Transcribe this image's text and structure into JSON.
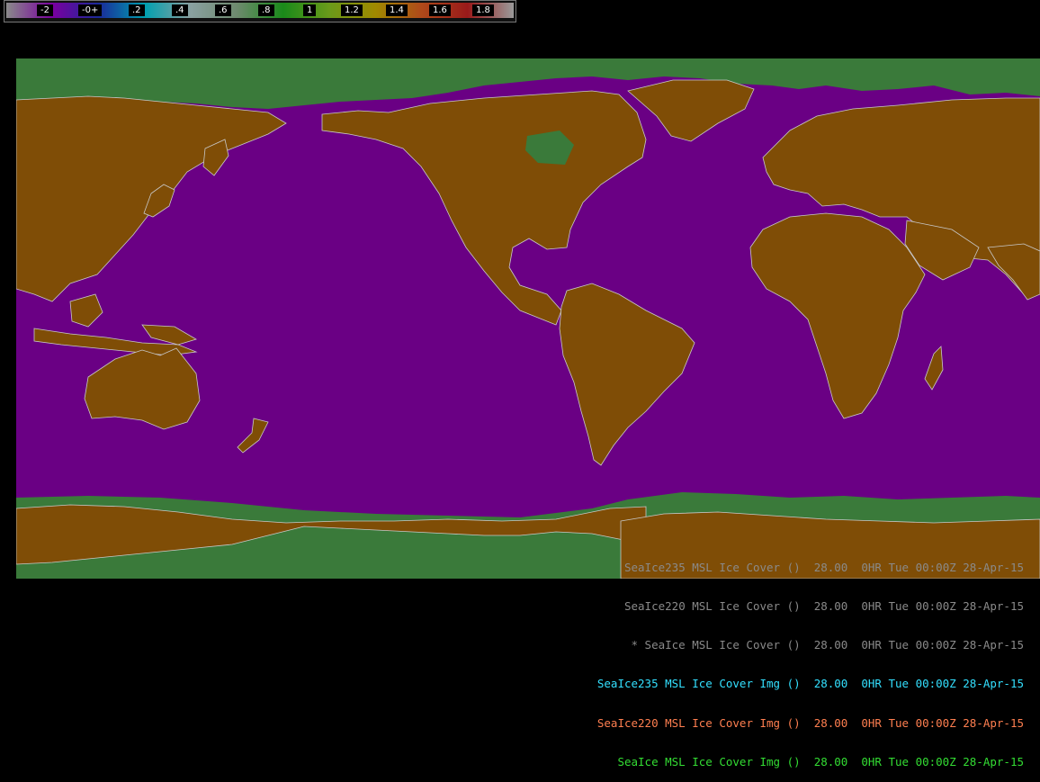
{
  "colorbar": {
    "gradient_stops": [
      "#8a8a8a",
      "#7a00a0",
      "#1a2a9a",
      "#00a0b0",
      "#8aa0a0",
      "#6e8a6e",
      "#1a8a1a",
      "#6a9a1a",
      "#a08a00",
      "#b04a1a",
      "#9a1a1a",
      "#9a9a9a"
    ],
    "labels": [
      "-2",
      "-0+",
      ".2",
      ".4",
      ".6",
      ".8",
      "1",
      "1.2",
      "1.4",
      "1.6",
      "1.8"
    ]
  },
  "map": {
    "ocean_color": "#6a0084",
    "land_color": "#7f4d06",
    "ice_color": "#3a7a3a",
    "border_color": "#c8c8c8"
  },
  "legend": [
    {
      "text": "SeaIce235 MSL Ice Cover ()  28.00  0HR Tue 00:00Z 28-Apr-15",
      "color": "#8a8a8a"
    },
    {
      "text": "SeaIce220 MSL Ice Cover ()  28.00  0HR Tue 00:00Z 28-Apr-15",
      "color": "#8a8a8a"
    },
    {
      "text": "* SeaIce MSL Ice Cover ()  28.00  0HR Tue 00:00Z 28-Apr-15",
      "color": "#8a8a8a"
    },
    {
      "text": "SeaIce235 MSL Ice Cover Img ()  28.00  0HR Tue 00:00Z 28-Apr-15",
      "color": "#33e0ff"
    },
    {
      "text": "SeaIce220 MSL Ice Cover Img ()  28.00  0HR Tue 00:00Z 28-Apr-15",
      "color": "#ff7f50"
    },
    {
      "text": "SeaIce MSL Ice Cover Img ()  28.00  0HR Tue 00:00Z 28-Apr-15",
      "color": "#33dd33"
    }
  ]
}
